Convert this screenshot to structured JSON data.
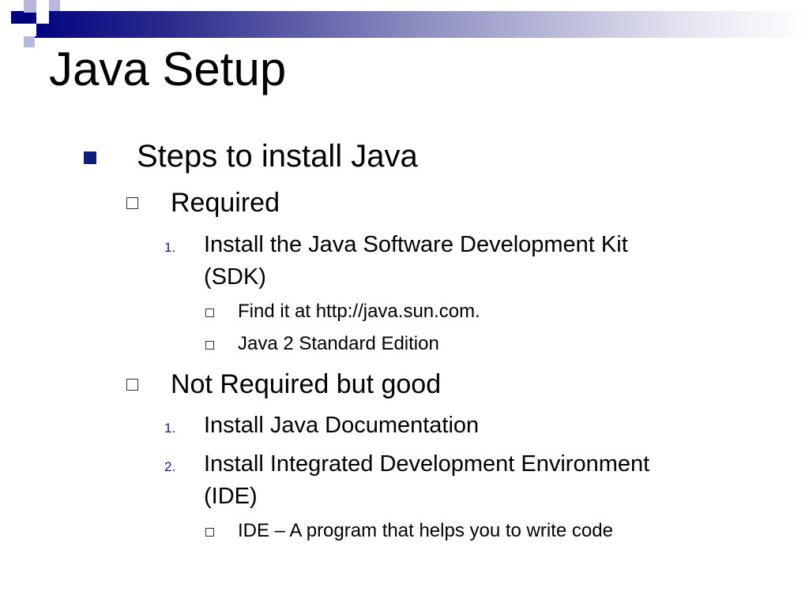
{
  "slide": {
    "title": "Java Setup",
    "colors": {
      "accent": "#0c1f7a",
      "header_gradient_start": "#000080",
      "square_light": "#b8b8dc"
    },
    "items": [
      {
        "text": "Steps to install Java",
        "marker": "square-bullet-icon"
      },
      {
        "text": "Required",
        "marker": "hollow-square-icon"
      },
      {
        "number": "1.",
        "text_line1": "Install the Java Software Development Kit",
        "text_line2": "(SDK)"
      },
      {
        "text": "Find it at http://java.sun.com.",
        "marker": "hollow-square-icon"
      },
      {
        "text": "Java 2 Standard Edition",
        "marker": "hollow-square-icon"
      },
      {
        "text": "Not Required but good",
        "marker": "hollow-square-icon"
      },
      {
        "number": "1.",
        "text": "Install Java Documentation"
      },
      {
        "number": "2.",
        "text_line1": "Install Integrated Development Environment",
        "text_line2": "(IDE)"
      },
      {
        "text": "IDE – A program that helps you to write code",
        "marker": "hollow-square-icon"
      }
    ]
  }
}
